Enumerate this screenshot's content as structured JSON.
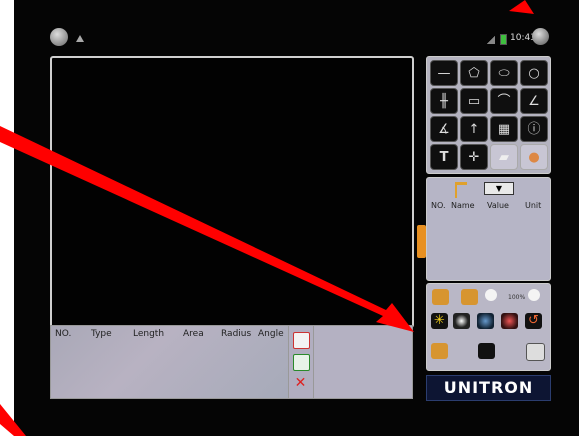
{
  "status_bar": {
    "time": "10:43"
  },
  "measure_table": {
    "columns": [
      "NO.",
      "Type",
      "Length",
      "Area",
      "Radius",
      "Angle"
    ]
  },
  "param_table": {
    "columns": [
      "NO.",
      "Name",
      "Value",
      "Unit"
    ],
    "dropdown_symbol": "▼"
  },
  "photo_panel": {
    "zoom_percent": "100%"
  },
  "logo": {
    "text": "UNITRON"
  },
  "colors": {
    "background": "#050505",
    "panel": "#b4b3c0",
    "annotation_arrow": "#ff0000",
    "logo_bg": "#0d1533",
    "handle": "#e89021"
  },
  "icons": [
    "home-icon",
    "warning-icon",
    "signal-icon",
    "battery-icon",
    "back-icon",
    "line-tool-icon",
    "pentagon-tool-icon",
    "ellipse-tool-icon",
    "circle-tool-icon",
    "parallel-line-icon",
    "rectangle-tool-icon",
    "arc-tool-icon",
    "angle-tool-icon",
    "angle2-tool-icon",
    "arrow-tool-icon",
    "grid-tool-icon",
    "info-icon",
    "text-tool-icon",
    "crosshair-tool-icon",
    "eraser-icon",
    "palette-icon",
    "pdf-export-icon",
    "excel-export-icon",
    "clear-icon",
    "zoom-in-icon",
    "zoom-out-icon",
    "search-icon",
    "brightness-icon",
    "contrast-icon",
    "saturation-icon",
    "color-balance-icon",
    "reset-icon",
    "open-folder-icon",
    "camera-icon",
    "save-icon"
  ]
}
